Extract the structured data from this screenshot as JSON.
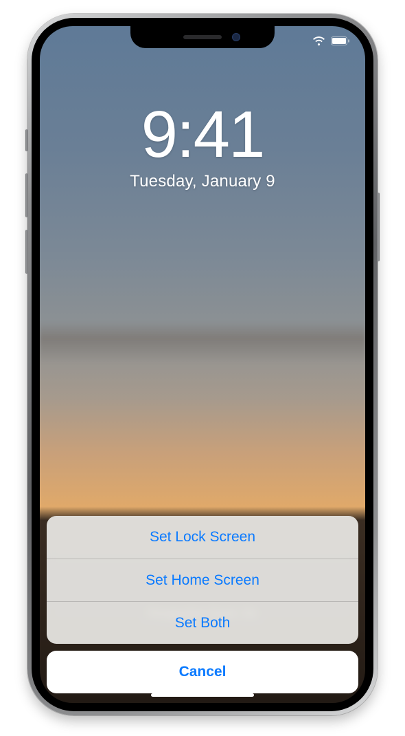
{
  "status": {
    "wifi": true,
    "battery": "full"
  },
  "lockscreen": {
    "time": "9:41",
    "date": "Tuesday, January 9"
  },
  "zoom_label": "Perspective Zoom: On",
  "action_sheet": {
    "options": [
      "Set Lock Screen",
      "Set Home Screen",
      "Set Both"
    ],
    "cancel": "Cancel"
  }
}
